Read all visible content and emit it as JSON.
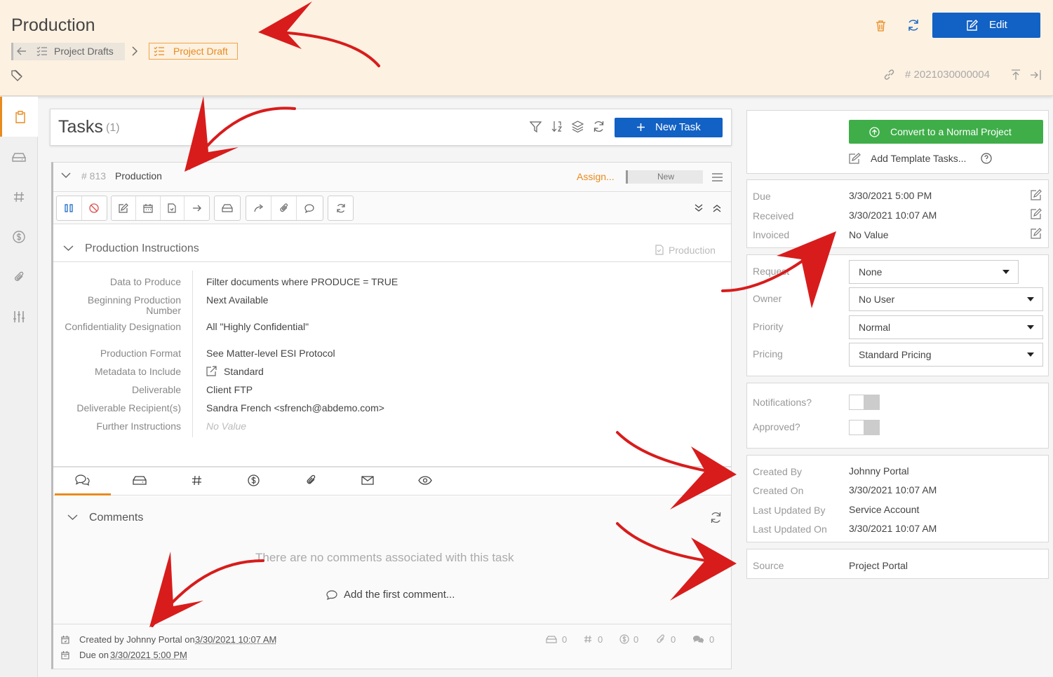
{
  "header": {
    "title": "Production",
    "breadcrumb_back": "Project Drafts",
    "breadcrumb_current": "Project Draft",
    "edit_label": "Edit",
    "record_id": "# 2021030000004"
  },
  "tasks": {
    "title": "Tasks",
    "count": "(1)",
    "new_task_label": "New Task"
  },
  "task": {
    "number": "# 813",
    "name": "Production",
    "assign_label": "Assign...",
    "status": "New",
    "section_title": "Production Instructions",
    "section_type": "Production",
    "fields": [
      {
        "label": "Data to Produce",
        "value": "Filter documents where PRODUCE = TRUE"
      },
      {
        "label": "Beginning Production Number",
        "value": "Next Available"
      },
      {
        "label": "Confidentiality Designation",
        "value": "All \"Highly Confidential\""
      },
      {
        "label": "Production Format",
        "value": "See Matter-level ESI Protocol"
      },
      {
        "label": "Metadata to Include",
        "value": "Standard"
      },
      {
        "label": "Deliverable",
        "value": "Client FTP"
      },
      {
        "label": "Deliverable Recipient(s)",
        "value": "Sandra French <sfrench@abdemo.com>"
      },
      {
        "label": "Further Instructions",
        "value": "No Value"
      }
    ],
    "comments_title": "Comments",
    "no_comments": "There are no comments associated with this task",
    "add_comment": "Add the first comment...",
    "created_by_prefix": "Created by Johnny Portal on",
    "created_on": "3/30/2021 10:07 AM",
    "due_prefix": "Due on",
    "due_on": "3/30/2021 5:00 PM",
    "counts": {
      "notes": "0",
      "hash": "0",
      "money": "0",
      "attach": "0",
      "comments": "0"
    }
  },
  "sidebar": {
    "convert_label": "Convert to a Normal Project",
    "add_template_label": "Add Template Tasks...",
    "dates": [
      {
        "label": "Due",
        "value": "3/30/2021 5:00 PM"
      },
      {
        "label": "Received",
        "value": "3/30/2021 10:07 AM"
      },
      {
        "label": "Invoiced",
        "value": "No Value"
      }
    ],
    "selects": [
      {
        "label": "Request",
        "value": "None"
      },
      {
        "label": "Owner",
        "value": "No User"
      },
      {
        "label": "Priority",
        "value": "Normal"
      },
      {
        "label": "Pricing",
        "value": "Standard Pricing"
      }
    ],
    "toggles": [
      {
        "label": "Notifications?"
      },
      {
        "label": "Approved?"
      }
    ],
    "audit": [
      {
        "label": "Created By",
        "value": "Johnny Portal"
      },
      {
        "label": "Created On",
        "value": "3/30/2021 10:07 AM"
      },
      {
        "label": "Last Updated By",
        "value": "Service Account"
      },
      {
        "label": "Last Updated On",
        "value": "3/30/2021 10:07 AM"
      }
    ],
    "source_label": "Source",
    "source_value": "Project Portal"
  },
  "colors": {
    "accent": "#e88a1e",
    "primary": "#1261c4",
    "success": "#3fae49",
    "annotation": "#d81c1c"
  }
}
